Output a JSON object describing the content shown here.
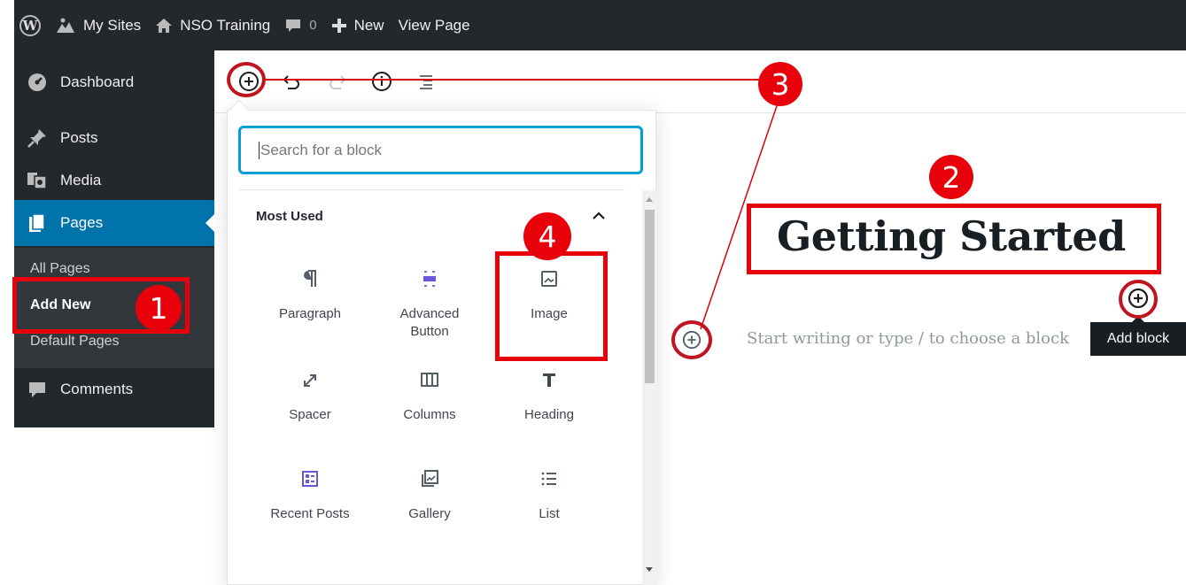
{
  "admin_bar": {
    "my_sites": "My Sites",
    "site_name": "NSO Training",
    "comments_count": "0",
    "new_label": "New",
    "view_page": "View Page"
  },
  "sidebar": {
    "items": [
      {
        "label": "Dashboard",
        "icon": "dashboard-icon"
      },
      {
        "label": "Posts",
        "icon": "pushpin-icon"
      },
      {
        "label": "Media",
        "icon": "media-icon"
      },
      {
        "label": "Pages",
        "icon": "pages-icon",
        "active": true
      },
      {
        "label": "Comments",
        "icon": "comment-icon"
      }
    ],
    "submenu": [
      "All Pages",
      "Add New",
      "Default Pages"
    ]
  },
  "editor": {
    "title": "Getting Started",
    "placeholder": "Start writing or type / to choose a block",
    "tooltip": "Add block"
  },
  "inserter": {
    "search_placeholder": "Search for a block",
    "section_title": "Most Used",
    "blocks": [
      {
        "label": "Paragraph",
        "icon": "paragraph-icon"
      },
      {
        "label": "Advanced Button",
        "icon": "advanced-button-icon"
      },
      {
        "label": "Image",
        "icon": "image-icon"
      },
      {
        "label": "Spacer",
        "icon": "spacer-icon"
      },
      {
        "label": "Columns",
        "icon": "columns-icon"
      },
      {
        "label": "Heading",
        "icon": "heading-icon"
      },
      {
        "label": "Recent Posts",
        "icon": "recent-posts-icon"
      },
      {
        "label": "Gallery",
        "icon": "gallery-icon"
      },
      {
        "label": "List",
        "icon": "list-icon"
      }
    ]
  },
  "annotations": {
    "badge_1": "1",
    "badge_2": "2",
    "badge_3": "3",
    "badge_4": "4"
  },
  "colors": {
    "admin_bg": "#23282d",
    "accent": "#0073aa",
    "annotation_red": "#e8000b",
    "search_focus": "#00a0d2"
  }
}
